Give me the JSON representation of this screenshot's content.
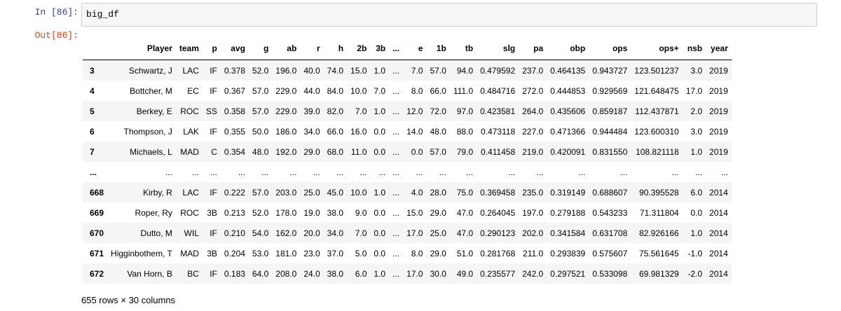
{
  "input_prompt": "In [86]:",
  "output_prompt": "Out[86]:",
  "code": "big_df",
  "table": {
    "columns": [
      "",
      "Player",
      "team",
      "p",
      "avg",
      "g",
      "ab",
      "r",
      "h",
      "2b",
      "3b",
      "...",
      "e",
      "1b",
      "tb",
      "slg",
      "pa",
      "obp",
      "ops",
      "ops+",
      "nsb",
      "year"
    ],
    "rows": [
      [
        "3",
        "Schwartz, J",
        "LAC",
        "IF",
        "0.378",
        "52.0",
        "196.0",
        "40.0",
        "74.0",
        "15.0",
        "1.0",
        "...",
        "7.0",
        "57.0",
        "94.0",
        "0.479592",
        "237.0",
        "0.464135",
        "0.943727",
        "123.501237",
        "3.0",
        "2019"
      ],
      [
        "4",
        "Bottcher, M",
        "EC",
        "IF",
        "0.367",
        "57.0",
        "229.0",
        "44.0",
        "84.0",
        "10.0",
        "7.0",
        "...",
        "8.0",
        "66.0",
        "111.0",
        "0.484716",
        "272.0",
        "0.444853",
        "0.929569",
        "121.648475",
        "17.0",
        "2019"
      ],
      [
        "5",
        "Berkey, E",
        "ROC",
        "SS",
        "0.358",
        "57.0",
        "229.0",
        "39.0",
        "82.0",
        "7.0",
        "1.0",
        "...",
        "12.0",
        "72.0",
        "97.0",
        "0.423581",
        "264.0",
        "0.435606",
        "0.859187",
        "112.437871",
        "2.0",
        "2019"
      ],
      [
        "6",
        "Thompson, J",
        "LAK",
        "IF",
        "0.355",
        "50.0",
        "186.0",
        "34.0",
        "66.0",
        "16.0",
        "0.0",
        "...",
        "14.0",
        "48.0",
        "88.0",
        "0.473118",
        "227.0",
        "0.471366",
        "0.944484",
        "123.600310",
        "3.0",
        "2019"
      ],
      [
        "7",
        "Michaels, L",
        "MAD",
        "C",
        "0.354",
        "48.0",
        "192.0",
        "29.0",
        "68.0",
        "11.0",
        "0.0",
        "...",
        "0.0",
        "57.0",
        "79.0",
        "0.411458",
        "219.0",
        "0.420091",
        "0.831550",
        "108.821118",
        "1.0",
        "2019"
      ],
      [
        "...",
        "...",
        "...",
        "...",
        "...",
        "...",
        "...",
        "...",
        "...",
        "...",
        "...",
        "...",
        "...",
        "...",
        "...",
        "...",
        "...",
        "...",
        "...",
        "...",
        "...",
        "..."
      ],
      [
        "668",
        "Kirby, R",
        "LAC",
        "IF",
        "0.222",
        "57.0",
        "203.0",
        "25.0",
        "45.0",
        "10.0",
        "1.0",
        "...",
        "4.0",
        "28.0",
        "75.0",
        "0.369458",
        "235.0",
        "0.319149",
        "0.688607",
        "90.395528",
        "6.0",
        "2014"
      ],
      [
        "669",
        "Roper, Ry",
        "ROC",
        "3B",
        "0.213",
        "52.0",
        "178.0",
        "19.0",
        "38.0",
        "9.0",
        "0.0",
        "...",
        "15.0",
        "29.0",
        "47.0",
        "0.264045",
        "197.0",
        "0.279188",
        "0.543233",
        "71.311804",
        "0.0",
        "2014"
      ],
      [
        "670",
        "Dutto, M",
        "WIL",
        "IF",
        "0.210",
        "54.0",
        "162.0",
        "20.0",
        "34.0",
        "7.0",
        "0.0",
        "...",
        "17.0",
        "25.0",
        "47.0",
        "0.290123",
        "202.0",
        "0.341584",
        "0.631708",
        "82.926166",
        "1.0",
        "2014"
      ],
      [
        "671",
        "Higginbothem, T",
        "MAD",
        "3B",
        "0.204",
        "53.0",
        "181.0",
        "23.0",
        "37.0",
        "5.0",
        "0.0",
        "...",
        "8.0",
        "29.0",
        "51.0",
        "0.281768",
        "211.0",
        "0.293839",
        "0.575607",
        "75.561645",
        "-1.0",
        "2014"
      ],
      [
        "672",
        "Van Horn, B",
        "BC",
        "IF",
        "0.183",
        "64.0",
        "208.0",
        "24.0",
        "38.0",
        "6.0",
        "1.0",
        "...",
        "17.0",
        "30.0",
        "49.0",
        "0.235577",
        "242.0",
        "0.297521",
        "0.533098",
        "69.981329",
        "-2.0",
        "2014"
      ]
    ]
  },
  "shape_text": "655 rows × 30 columns"
}
